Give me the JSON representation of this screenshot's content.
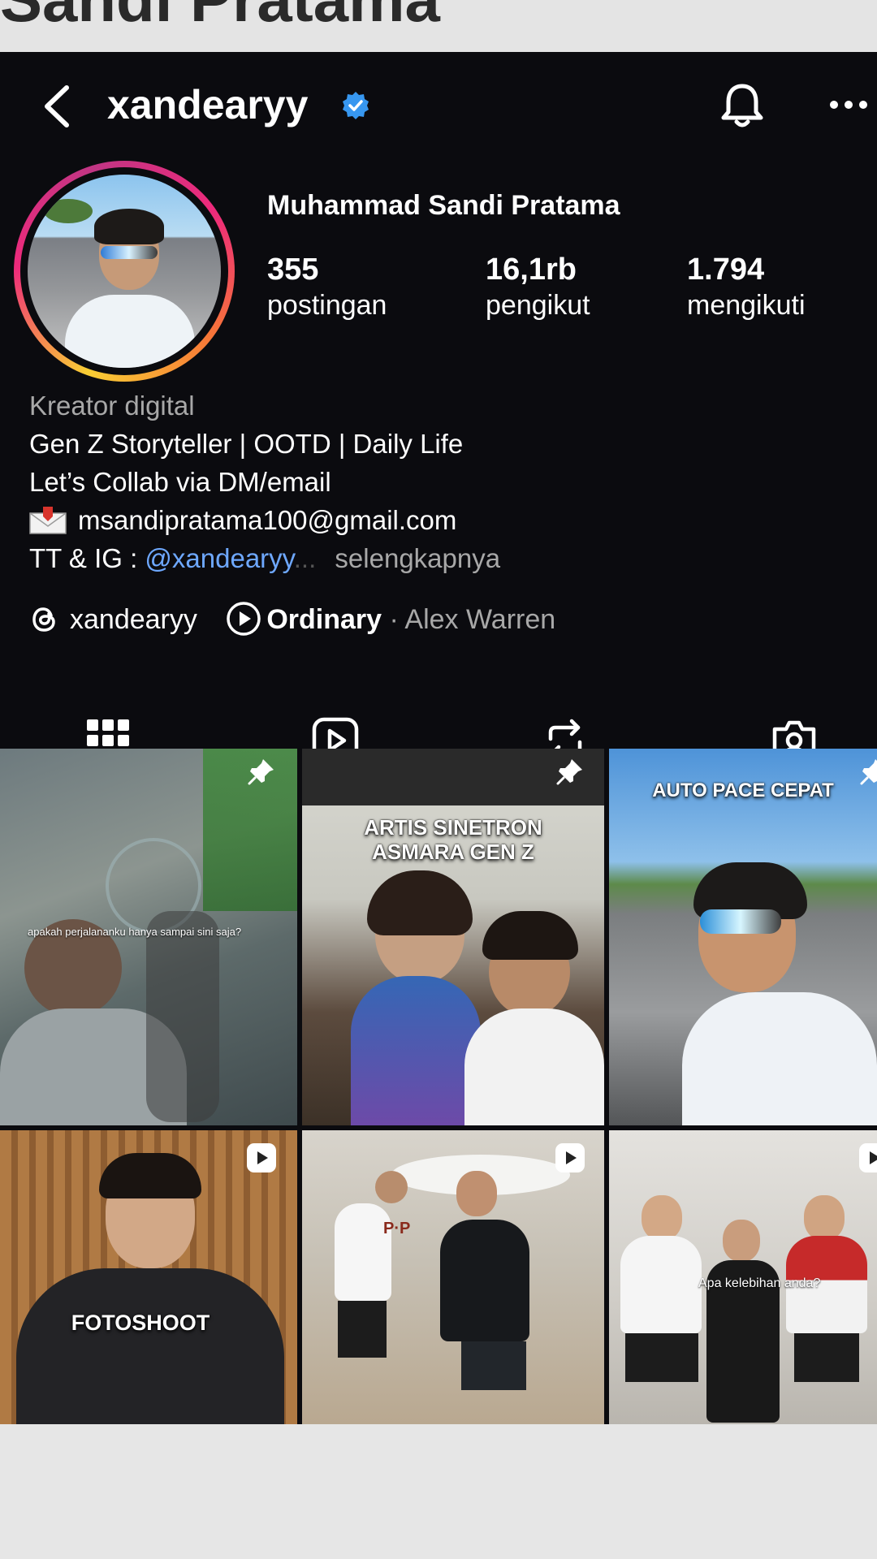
{
  "background_heading": "Sandi Pratama",
  "header": {
    "username": "xandearyy",
    "verified": true
  },
  "profile": {
    "full_name": "Muhammad Sandi Pratama",
    "stats": [
      {
        "value": "355",
        "label": "postingan"
      },
      {
        "value": "16,1rb",
        "label": "pengikut"
      },
      {
        "value": "1.794",
        "label": "mengikuti"
      }
    ]
  },
  "bio": {
    "category": "Kreator digital",
    "line1": "Gen Z Storyteller | OOTD | Daily Life",
    "line2": "Let’s Collab via DM/email",
    "email": "msandipratama100@gmail.com",
    "line4_prefix": "TT & IG : ",
    "line4_handle": "@xandearyy",
    "line4_ellipsis": "...",
    "more": "selengkapnya"
  },
  "meta": {
    "threads_handle": "xandearyy",
    "song": "Ordinary",
    "separator": " · ",
    "artist": "Alex Warren"
  },
  "tabs": [
    "grid-icon",
    "reels-icon",
    "repost-icon",
    "tagged-icon"
  ],
  "posts": [
    {
      "caption": "",
      "small_text": "apakah perjalananku hanya sampai sini saja?",
      "pinned": true
    },
    {
      "caption": "ARTIS SINETRON\nASMARA GEN Z",
      "small_text": "",
      "pinned": true
    },
    {
      "caption": "AUTO PACE CEPAT",
      "small_text": "",
      "pinned": true
    },
    {
      "caption": "FOTOSHOOT",
      "small_text": "",
      "reel": true
    },
    {
      "caption": "",
      "small_text": "",
      "sign_text": "P·P",
      "reel": true
    },
    {
      "caption": "",
      "small_text": "Apa kelebihan anda?",
      "reel": true
    }
  ],
  "colors": {
    "background": "#0b0b0f",
    "link": "#6ea8ff",
    "secondary_text": "#a8a8a8",
    "verified": "#3797f0"
  }
}
